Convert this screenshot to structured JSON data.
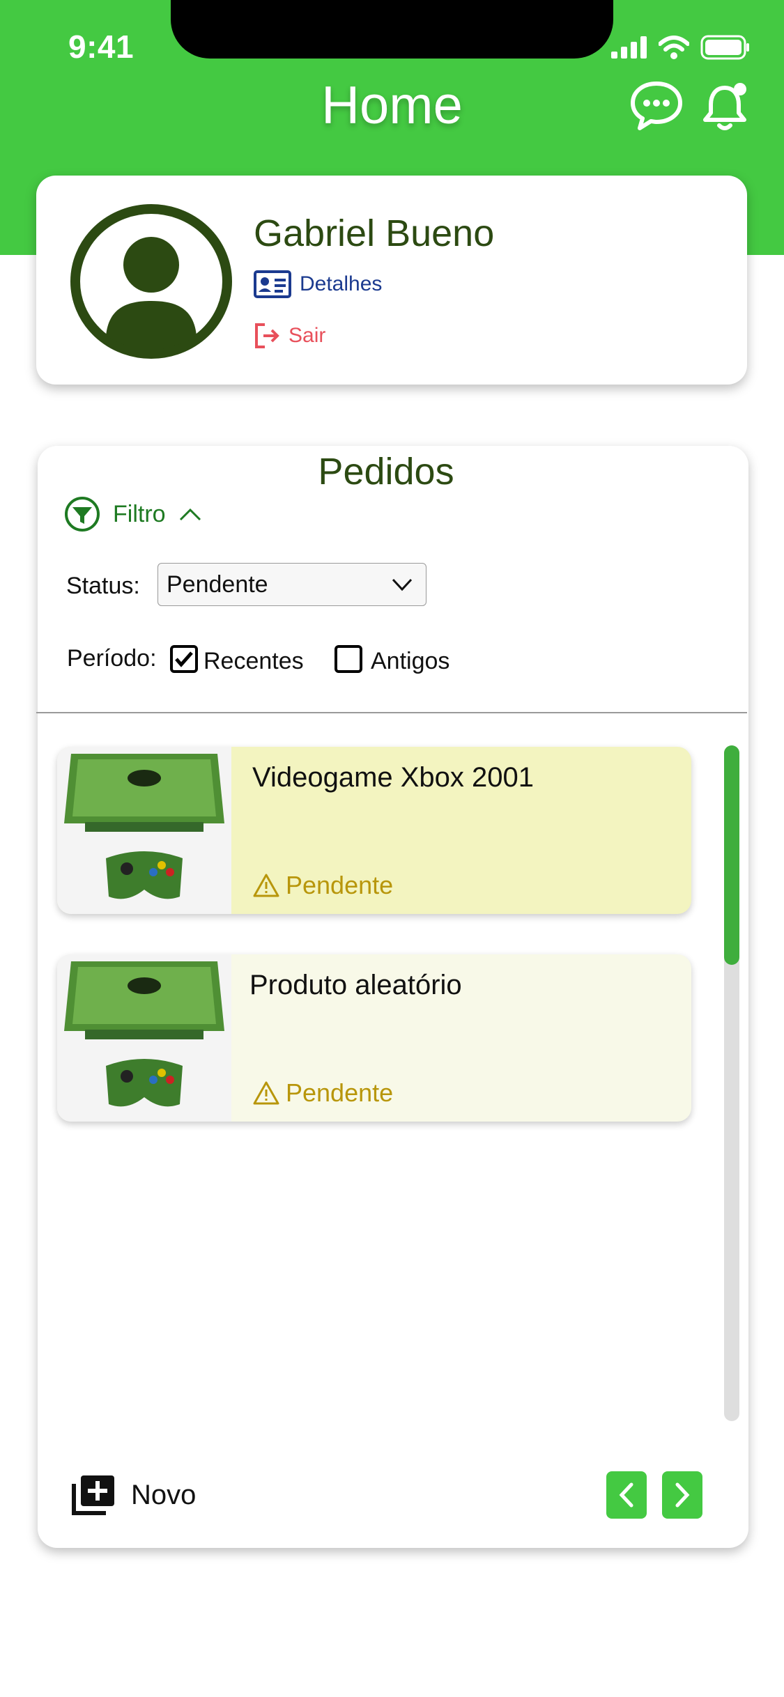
{
  "status_bar": {
    "time": "9:41"
  },
  "header": {
    "title": "Home",
    "chat_icon": "chat-bubble-icon",
    "bell_icon": "notification-bell-icon"
  },
  "profile": {
    "name": "Gabriel Bueno",
    "details_label": "Detalhes",
    "logout_label": "Sair"
  },
  "orders": {
    "title": "Pedidos",
    "filter_label": "Filtro",
    "status_label": "Status:",
    "status_value": "Pendente",
    "period_label": "Período:",
    "period_options": [
      {
        "label": "Recentes",
        "checked": true
      },
      {
        "label": "Antigos",
        "checked": false
      }
    ],
    "items": [
      {
        "title": "Videogame Xbox 2001",
        "status": "Pendente",
        "bg": "#f3f4c0"
      },
      {
        "title": "Produto aleatório",
        "status": "Pendente",
        "bg": "#f8f9e8"
      }
    ],
    "new_label": "Novo"
  },
  "colors": {
    "brand": "#44c942",
    "dark_green": "#2c4a12",
    "link_blue": "#1b3a8f",
    "logout_red": "#e8505b",
    "pending": "#b8960b"
  }
}
